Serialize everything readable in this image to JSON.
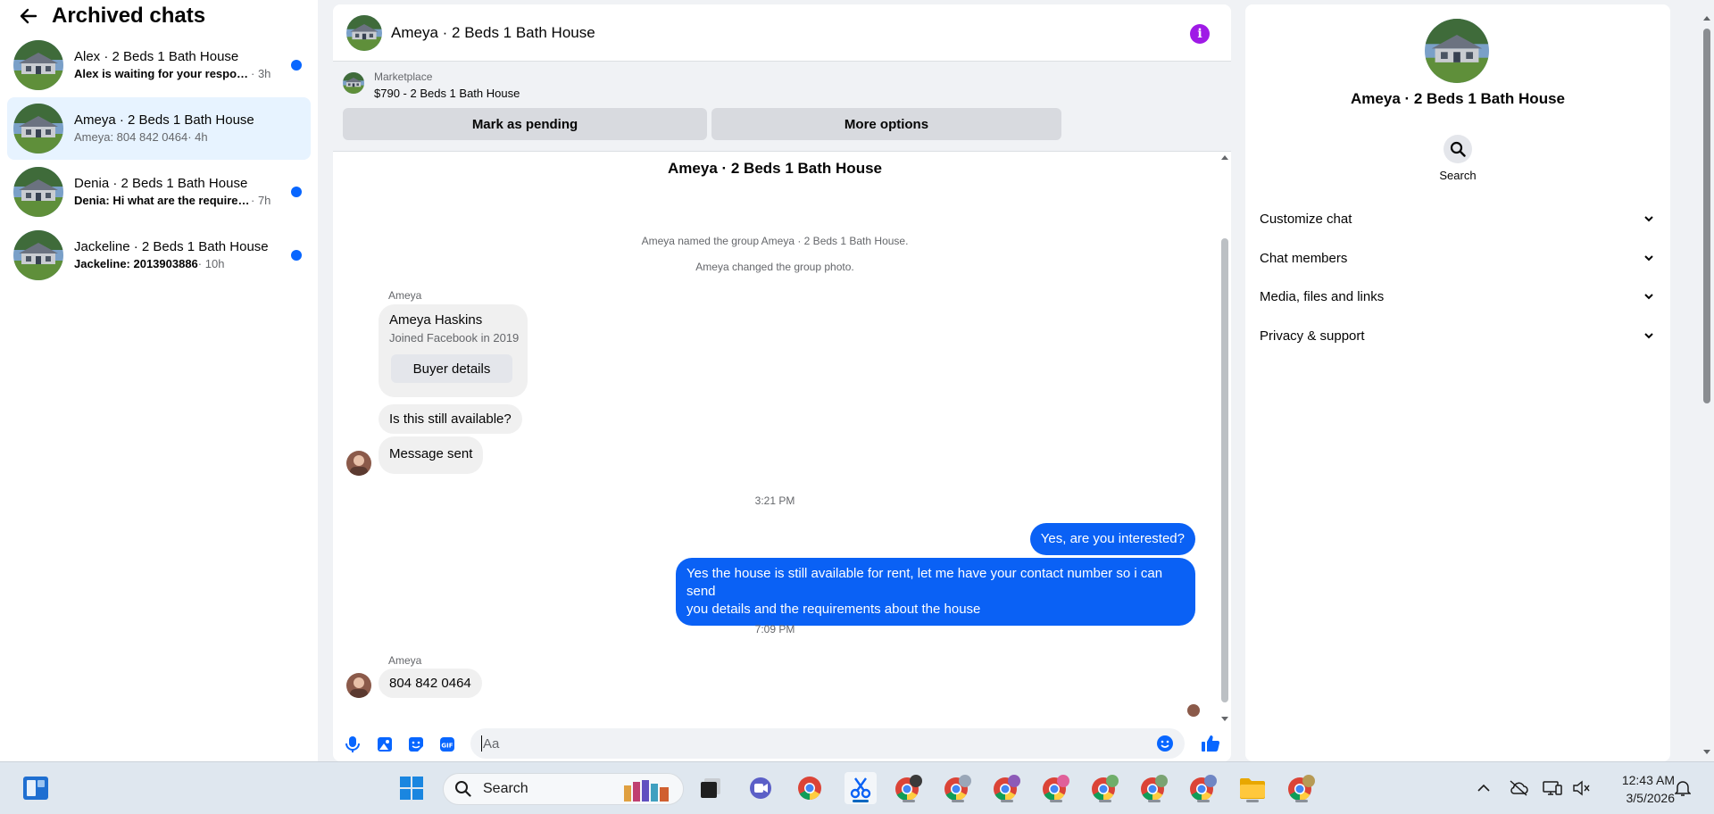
{
  "sidebar": {
    "title": "Archived chats",
    "chats": [
      {
        "name": "Alex · 2 Beds 1 Bath House",
        "preview": "Alex is waiting for your response.",
        "time": " · 3h",
        "unread": true
      },
      {
        "name": "Ameya · 2 Beds 1 Bath House",
        "preview": "Ameya: 804 842 0464",
        "time": " · 4h",
        "unread": false
      },
      {
        "name": "Denia · 2 Beds 1 Bath House",
        "preview": "Denia: Hi what are the requiremen...",
        "time": " · 7h",
        "unread": true
      },
      {
        "name": "Jackeline · 2 Beds 1 Bath House",
        "preview": "Jackeline: 2013903886",
        "time": " · 10h",
        "unread": true
      }
    ]
  },
  "chat": {
    "header_title": "Ameya · 2 Beds 1 Bath House",
    "marketplace_label": "Marketplace",
    "listing": "$790 - 2 Beds 1 Bath House",
    "mark_pending": "Mark as pending",
    "more_options": "More options",
    "thread_title": "Ameya · 2 Beds 1 Bath House",
    "events": [
      "Ameya named the group Ameya · 2 Beds 1 Bath House.",
      "Ameya changed the group photo."
    ],
    "sender": "Ameya",
    "profile_card": {
      "name": "Ameya Haskins",
      "joined": "Joined Facebook in 2019",
      "button": "Buyer details"
    },
    "msg_in_1": "Is this still available?",
    "msg_in_2": "Message sent",
    "time_1": "3:21 PM",
    "msg_out_1": "Yes, are you interested?",
    "msg_out_2_line1": "Yes the house is still available for rent, let me have your contact number so i can send",
    "msg_out_2_line2": "you details and the requirements about the house",
    "time_2": "7:09 PM",
    "msg_in_3": "804 842 0464",
    "composer_placeholder": "Aa"
  },
  "details": {
    "name": "Ameya · 2 Beds 1 Bath House",
    "search_label": "Search",
    "sections": [
      "Customize chat",
      "Chat members",
      "Media, files and links",
      "Privacy & support"
    ]
  },
  "taskbar": {
    "search_label": "Search",
    "time": "12:43 AM",
    "date": "3/5/2026"
  },
  "colors": {
    "accent": "#0866ff",
    "outgoing_bubble": "#0a61f5",
    "info_icon": "#9f1ae6",
    "active_chat_bg": "#e7f3ff"
  }
}
